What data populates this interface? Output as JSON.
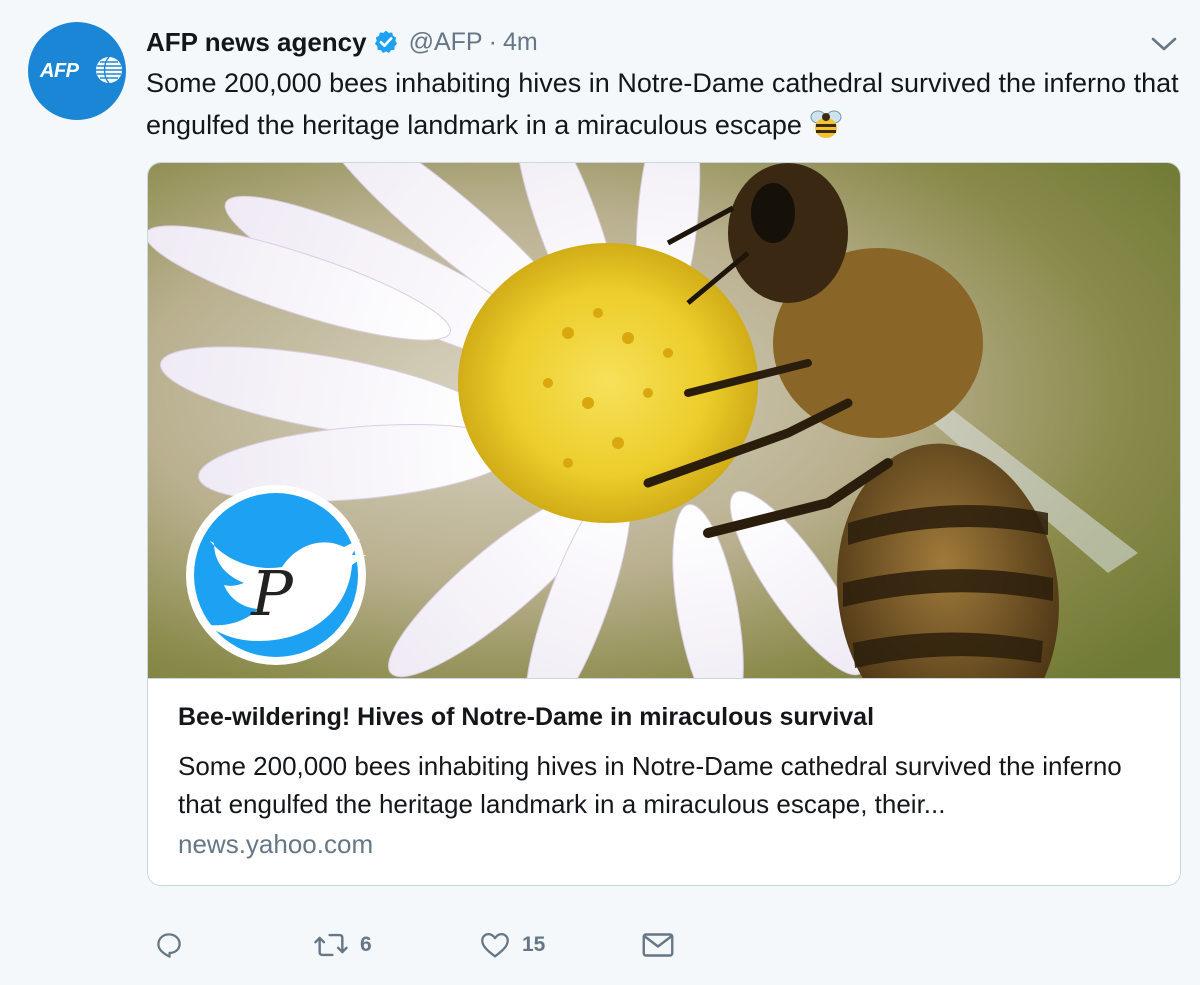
{
  "tweet": {
    "author_name": "AFP news agency",
    "avatar_text": "AFP",
    "handle": "@AFP",
    "separator": "·",
    "time": "4m",
    "text": "Some 200,000 bees inhabiting hives in Notre-Dame cathedral survived the inferno that engulfed the heritage landmark in a miraculous escape",
    "emoji": "bee-emoji"
  },
  "card": {
    "watermark_letter": "P",
    "title": "Bee-wildering! Hives of Notre-Dame in miraculous survival",
    "description": "Some 200,000 bees inhabiting hives in Notre-Dame cathedral survived the inferno that engulfed the heritage landmark in a miraculous escape, their...",
    "domain": "news.yahoo.com"
  },
  "actions": {
    "reply_count": "",
    "retweet_count": "6",
    "like_count": "15"
  },
  "icons": {
    "verified": "verified-badge-icon",
    "chevron": "chevron-down-icon",
    "reply": "reply-icon",
    "retweet": "retweet-icon",
    "like": "heart-icon",
    "message": "envelope-icon"
  },
  "colors": {
    "background": "#f5f8fa",
    "brand_blue": "#1da1f2",
    "afp_blue": "#1b86d6",
    "text": "#14171a",
    "muted": "#657786",
    "border": "#ccd6dd"
  }
}
